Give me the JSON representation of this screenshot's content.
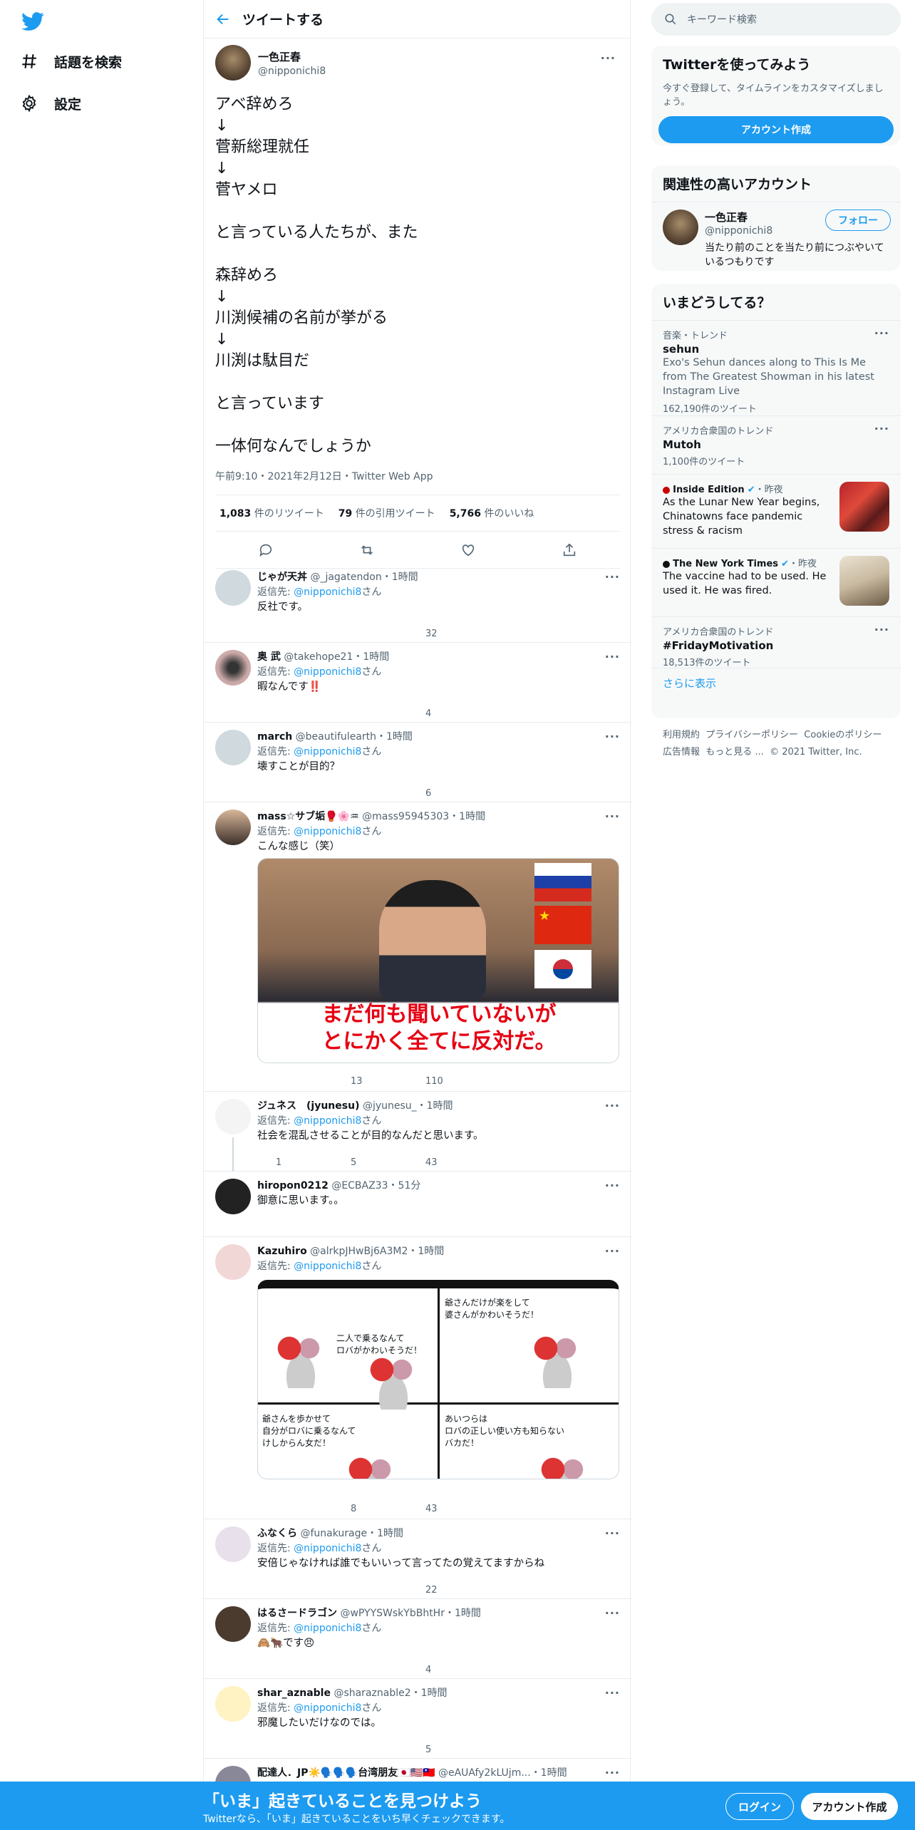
{
  "nav": {
    "explore_label": "話題を検索",
    "settings_label": "設定"
  },
  "header": {
    "title": "ツイートする"
  },
  "focus_tweet": {
    "author_name": "一色正春",
    "author_handle": "@nipponichi8",
    "text": "アベ辞めろ\n↓\n菅新総理就任\n↓\n菅ヤメロ\n\nと言っている人たちが、また\n\n森辞めろ\n↓\n川渕候補の名前が挙がる\n↓\n川渕は駄目だ\n\nと言っています\n\n一体何なんでしょうか",
    "meta": "午前9:10・2021年2月12日・Twitter Web App",
    "retweets": "1,083",
    "retweets_label": "件のリツイート",
    "quotes": "79",
    "quotes_label": "件の引用ツイート",
    "likes": "5,766",
    "likes_label": "件のいいね"
  },
  "reply_prefix": "返信先:",
  "reply_suffix": "さん",
  "reply_to": "@nipponichi8",
  "replies": [
    {
      "name": "じゃが天丼",
      "handle": "@_jagatendon",
      "time": "・1時間",
      "text": "反社です。",
      "reply": "",
      "rt": "",
      "like": "32"
    },
    {
      "name": "奥 武",
      "handle": "@takehope21",
      "time": "・1時間",
      "text": "暇なんです‼️",
      "reply": "",
      "rt": "",
      "like": "4"
    },
    {
      "name": "march",
      "handle": "@beautifulearth",
      "time": "・1時間",
      "text": "壊すことが目的？",
      "reply": "",
      "rt": "",
      "like": "6"
    },
    {
      "name": "mass☆サブ垢🥊🌸♒",
      "handle": "@mass95945303",
      "time": "・1時間",
      "text": "こんな感じ（笑）",
      "reply": "",
      "rt": "13",
      "like": "110",
      "media_caption_1": "まだ何も聞いていないが",
      "media_caption_2": "とにかく全てに反対だ。"
    },
    {
      "name": "ジュネス　(jyunesu)",
      "handle": "@jyunesu_",
      "time": "・1時間",
      "text": "社会を混乱させることが目的なんだと思います。",
      "reply": "1",
      "rt": "5",
      "like": "43"
    },
    {
      "name": "hiropon0212",
      "handle": "@ECBAZ33",
      "time": "・51分",
      "text": "御意に思います。。",
      "reply": "",
      "rt": "",
      "like": ""
    },
    {
      "name": "Kazuhiro",
      "handle": "@alrkpJHwBj6A3M2",
      "time": "・1時間",
      "text": "",
      "reply": "",
      "rt": "8",
      "like": "43",
      "comic_1": "二人で乗るなんて\nロバがかわいそうだ！",
      "comic_2": "爺さんだけが楽をして\n婆さんがかわいそうだ！",
      "comic_3": "爺さんを歩かせて\n自分がロバに乗るなんて\nけしからん女だ！",
      "comic_4": "あいつらは\nロバの正しい使い方も知らない\nバカだ！"
    },
    {
      "name": "ふなくら",
      "handle": "@funakurage",
      "time": "・1時間",
      "text": "安倍じゃなければ誰でもいいって言ってたの覚えてますからね",
      "reply": "",
      "rt": "",
      "like": "22"
    },
    {
      "name": "はるさードラゴン",
      "handle": "@wPYYSWskYbBhtHr",
      "time": "・1時間",
      "text": "🙈🐂です😠",
      "reply": "",
      "rt": "",
      "like": "4"
    },
    {
      "name": "shar_aznable",
      "handle": "@sharaznable2",
      "time": "・1時間",
      "text": "邪魔したいだけなのでは。",
      "reply": "",
      "rt": "",
      "like": "5"
    },
    {
      "name": "配達人．JP☀️🗣️🗣️🗣️台湾朋友🇯🇵🇺🇸🇹🇼",
      "handle": "@eAUAfy2kLUjm...",
      "time": "・1時間",
      "text": "",
      "reply": "",
      "rt": "",
      "like": ""
    }
  ],
  "search": {
    "placeholder": "キーワード検索"
  },
  "signup": {
    "title": "Twitterを使ってみよう",
    "subtitle": "今すぐ登録して、タイムラインをカスタマイズしましょう。",
    "button": "アカウント作成"
  },
  "related": {
    "title": "関連性の高いアカウント",
    "name": "一色正春",
    "handle": "@nipponichi8",
    "follow": "フォロー",
    "bio": "当たり前のことを当たり前につぶやいているつもりです"
  },
  "trends": {
    "title": "いまどうしてる？",
    "items": [
      {
        "cat": "音楽・トレンド",
        "title": "sehun",
        "desc": "Exo's Sehun dances along to This Is Me from The Greatest Showman in his latest Instagram Live",
        "count": "162,190件のツイート"
      },
      {
        "cat": "アメリカ合衆国のトレンド",
        "title": "Mutoh",
        "desc": "",
        "count": "1,100件のツイート"
      },
      {
        "cat": "Inside Edition",
        "time": "・昨夜",
        "title": "",
        "desc": "As the Lunar New Year begins, Chinatowns face pandemic stress & racism",
        "count": ""
      },
      {
        "cat": "The New York Times",
        "time": "・昨夜",
        "title": "",
        "desc": "The vaccine had to be used. He used it. He was fired.",
        "count": ""
      },
      {
        "cat": "アメリカ合衆国のトレンド",
        "title": "#FridayMotivation",
        "desc": "",
        "count": "18,513件のツイート"
      }
    ],
    "more": "さらに表示"
  },
  "footer": {
    "links": [
      "利用規約",
      "プライバシーポリシー",
      "Cookieのポリシー",
      "広告情報",
      "もっと見る ...",
      "© 2021 Twitter, Inc."
    ]
  },
  "bottom": {
    "title": "「いま」起きていることを見つけよう",
    "subtitle": "Twitterなら、「いま」起きていることをいち早くチェックできます。",
    "login": "ログイン",
    "signup": "アカウント作成"
  },
  "colors": {
    "accent": "#1d9bf0",
    "border": "#e6ecf0",
    "panel": "#f7f9f9"
  }
}
